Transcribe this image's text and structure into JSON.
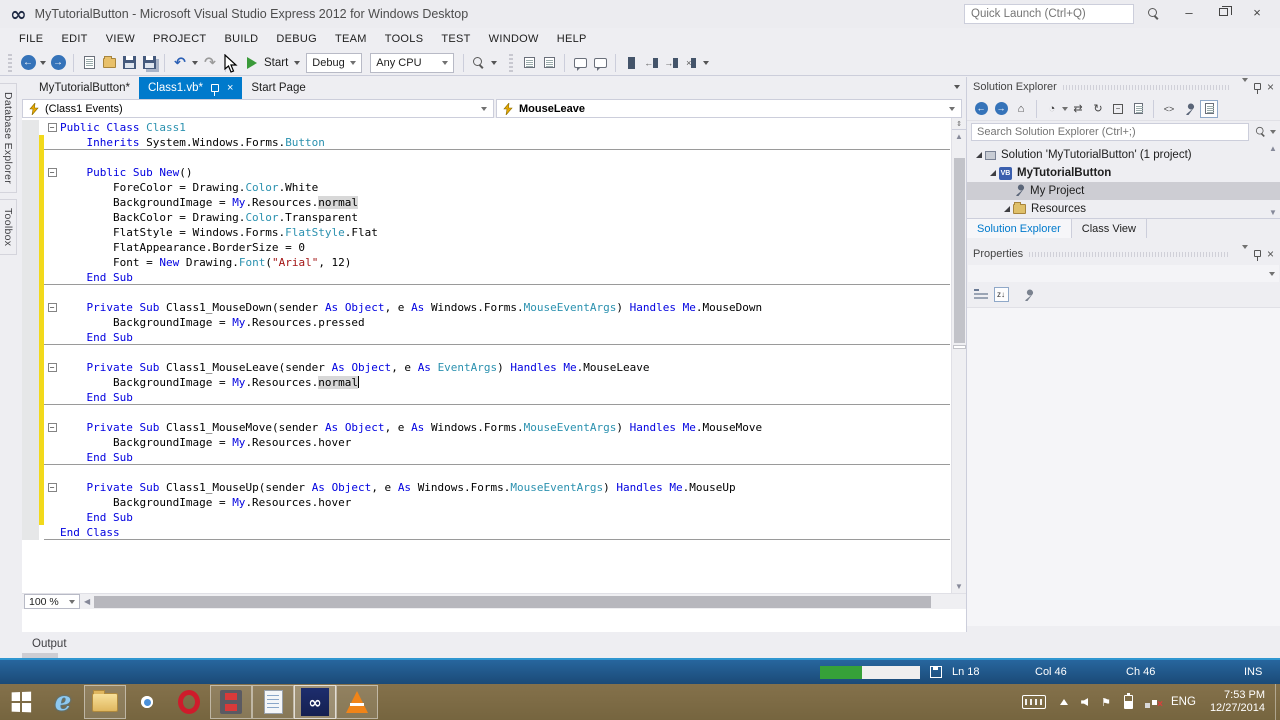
{
  "colors": {
    "accent": "#007acc",
    "keyword": "#0000e0",
    "type_name": "#2b91af",
    "string": "#a31515",
    "change_bar": "#f2d91b",
    "statusbar": "#1b4a77",
    "progress_green": "#36a139",
    "taskbar": "#7d6b46"
  },
  "window": {
    "title": "MyTutorialButton - Microsoft Visual Studio Express 2012 for Windows Desktop",
    "quick_launch_placeholder": "Quick Launch (Ctrl+Q)",
    "minimize": "–",
    "close": "×"
  },
  "menu": {
    "items": [
      "FILE",
      "EDIT",
      "VIEW",
      "PROJECT",
      "BUILD",
      "DEBUG",
      "TEAM",
      "TOOLS",
      "TEST",
      "WINDOW",
      "HELP"
    ]
  },
  "toolbar": {
    "start_label": "Start",
    "config_value": "Debug",
    "platform_value": "Any CPU"
  },
  "side_tabs": {
    "items": [
      "Database Explorer",
      "Toolbox"
    ]
  },
  "editor": {
    "tabs": [
      {
        "label": "MyTutorialButton*"
      },
      {
        "label": "Class1.vb*"
      },
      {
        "label": "Start Page"
      }
    ],
    "nav": {
      "types_value": "(Class1 Events)",
      "members_value": "MouseLeave"
    },
    "zoom_value": "100 %",
    "code": {
      "lines": [
        {
          "fold": true,
          "changed": false,
          "sep": false,
          "segments": [
            [
              "k",
              "Public Class "
            ],
            [
              "t",
              "Class1"
            ]
          ]
        },
        {
          "fold": false,
          "changed": true,
          "sep": true,
          "segments": [
            [
              "n",
              "    "
            ],
            [
              "k",
              "Inherits "
            ],
            [
              "n",
              "System.Windows.Forms."
            ],
            [
              "t",
              "Button"
            ]
          ]
        },
        {
          "fold": false,
          "changed": true,
          "sep": false,
          "segments": []
        },
        {
          "fold": true,
          "changed": true,
          "sep": false,
          "segments": [
            [
              "n",
              "    "
            ],
            [
              "k",
              "Public Sub New"
            ],
            [
              "n",
              "()"
            ]
          ]
        },
        {
          "fold": false,
          "changed": true,
          "sep": false,
          "segments": [
            [
              "n",
              "        ForeColor = Drawing."
            ],
            [
              "t",
              "Color"
            ],
            [
              "n",
              ".White"
            ]
          ]
        },
        {
          "fold": false,
          "changed": true,
          "sep": false,
          "segments": [
            [
              "n",
              "        BackgroundImage = "
            ],
            [
              "k",
              "My"
            ],
            [
              "n",
              ".Resources."
            ],
            [
              "h",
              "normal"
            ]
          ]
        },
        {
          "fold": false,
          "changed": true,
          "sep": false,
          "segments": [
            [
              "n",
              "        BackColor = Drawing."
            ],
            [
              "t",
              "Color"
            ],
            [
              "n",
              ".Transparent"
            ]
          ]
        },
        {
          "fold": false,
          "changed": true,
          "sep": false,
          "segments": [
            [
              "n",
              "        FlatStyle = Windows.Forms."
            ],
            [
              "t",
              "FlatStyle"
            ],
            [
              "n",
              ".Flat"
            ]
          ]
        },
        {
          "fold": false,
          "changed": true,
          "sep": false,
          "segments": [
            [
              "n",
              "        FlatAppearance.BorderSize = 0"
            ]
          ]
        },
        {
          "fold": false,
          "changed": true,
          "sep": false,
          "segments": [
            [
              "n",
              "        Font = "
            ],
            [
              "k",
              "New"
            ],
            [
              "n",
              " Drawing."
            ],
            [
              "t",
              "Font"
            ],
            [
              "n",
              "("
            ],
            [
              "s",
              "\"Arial\""
            ],
            [
              "n",
              ", 12)"
            ]
          ]
        },
        {
          "fold": false,
          "changed": true,
          "sep": true,
          "segments": [
            [
              "n",
              "    "
            ],
            [
              "k",
              "End Sub"
            ]
          ]
        },
        {
          "fold": false,
          "changed": true,
          "sep": false,
          "segments": []
        },
        {
          "fold": true,
          "changed": true,
          "sep": false,
          "segments": [
            [
              "n",
              "    "
            ],
            [
              "k",
              "Private Sub "
            ],
            [
              "n",
              "Class1_MouseDown(sender "
            ],
            [
              "k",
              "As "
            ],
            [
              "k",
              "Object"
            ],
            [
              "n",
              ", e "
            ],
            [
              "k",
              "As "
            ],
            [
              "n",
              "Windows.Forms."
            ],
            [
              "t",
              "MouseEventArgs"
            ],
            [
              "n",
              ") "
            ],
            [
              "k",
              "Handles "
            ],
            [
              "k",
              "Me"
            ],
            [
              "n",
              ".MouseDown"
            ]
          ]
        },
        {
          "fold": false,
          "changed": true,
          "sep": false,
          "segments": [
            [
              "n",
              "        BackgroundImage = "
            ],
            [
              "k",
              "My"
            ],
            [
              "n",
              ".Resources.pressed"
            ]
          ]
        },
        {
          "fold": false,
          "changed": true,
          "sep": true,
          "segments": [
            [
              "n",
              "    "
            ],
            [
              "k",
              "End Sub"
            ]
          ]
        },
        {
          "fold": false,
          "changed": true,
          "sep": false,
          "segments": []
        },
        {
          "fold": true,
          "changed": true,
          "sep": false,
          "segments": [
            [
              "n",
              "    "
            ],
            [
              "k",
              "Private Sub "
            ],
            [
              "n",
              "Class1_MouseLeave(sender "
            ],
            [
              "k",
              "As "
            ],
            [
              "k",
              "Object"
            ],
            [
              "n",
              ", e "
            ],
            [
              "k",
              "As "
            ],
            [
              "t",
              "EventArgs"
            ],
            [
              "n",
              ") "
            ],
            [
              "k",
              "Handles "
            ],
            [
              "k",
              "Me"
            ],
            [
              "n",
              ".MouseLeave"
            ]
          ]
        },
        {
          "fold": false,
          "changed": true,
          "sep": false,
          "caret": true,
          "segments": [
            [
              "n",
              "        BackgroundImage = "
            ],
            [
              "k",
              "My"
            ],
            [
              "n",
              ".Resources."
            ],
            [
              "h",
              "normal"
            ]
          ]
        },
        {
          "fold": false,
          "changed": true,
          "sep": true,
          "segments": [
            [
              "n",
              "    "
            ],
            [
              "k",
              "End Sub"
            ]
          ]
        },
        {
          "fold": false,
          "changed": true,
          "sep": false,
          "segments": []
        },
        {
          "fold": true,
          "changed": true,
          "sep": false,
          "segments": [
            [
              "n",
              "    "
            ],
            [
              "k",
              "Private Sub "
            ],
            [
              "n",
              "Class1_MouseMove(sender "
            ],
            [
              "k",
              "As "
            ],
            [
              "k",
              "Object"
            ],
            [
              "n",
              ", e "
            ],
            [
              "k",
              "As "
            ],
            [
              "n",
              "Windows.Forms."
            ],
            [
              "t",
              "MouseEventArgs"
            ],
            [
              "n",
              ") "
            ],
            [
              "k",
              "Handles "
            ],
            [
              "k",
              "Me"
            ],
            [
              "n",
              ".MouseMove"
            ]
          ]
        },
        {
          "fold": false,
          "changed": true,
          "sep": false,
          "segments": [
            [
              "n",
              "        BackgroundImage = "
            ],
            [
              "k",
              "My"
            ],
            [
              "n",
              ".Resources.hover"
            ]
          ]
        },
        {
          "fold": false,
          "changed": true,
          "sep": true,
          "segments": [
            [
              "n",
              "    "
            ],
            [
              "k",
              "End Sub"
            ]
          ]
        },
        {
          "fold": false,
          "changed": true,
          "sep": false,
          "segments": []
        },
        {
          "fold": true,
          "changed": true,
          "sep": false,
          "segments": [
            [
              "n",
              "    "
            ],
            [
              "k",
              "Private Sub "
            ],
            [
              "n",
              "Class1_MouseUp(sender "
            ],
            [
              "k",
              "As "
            ],
            [
              "k",
              "Object"
            ],
            [
              "n",
              ", e "
            ],
            [
              "k",
              "As "
            ],
            [
              "n",
              "Windows.Forms."
            ],
            [
              "t",
              "MouseEventArgs"
            ],
            [
              "n",
              ") "
            ],
            [
              "k",
              "Handles "
            ],
            [
              "k",
              "Me"
            ],
            [
              "n",
              ".MouseUp"
            ]
          ]
        },
        {
          "fold": false,
          "changed": true,
          "sep": false,
          "segments": [
            [
              "n",
              "        BackgroundImage = "
            ],
            [
              "k",
              "My"
            ],
            [
              "n",
              ".Resources.hover"
            ]
          ]
        },
        {
          "fold": false,
          "changed": true,
          "sep": false,
          "segments": [
            [
              "n",
              "    "
            ],
            [
              "k",
              "End Sub"
            ]
          ]
        },
        {
          "fold": false,
          "changed": false,
          "sep": true,
          "segments": [
            [
              "k",
              "End Class"
            ]
          ]
        }
      ]
    }
  },
  "solution_explorer": {
    "title": "Solution Explorer",
    "search_placeholder": "Search Solution Explorer (Ctrl+;)",
    "tree": [
      {
        "label": "Solution 'MyTutorialButton' (1 project)"
      },
      {
        "label": "MyTutorialButton"
      },
      {
        "label": "My Project"
      },
      {
        "label": "Resources"
      }
    ],
    "bottom_tabs": [
      "Solution Explorer",
      "Class View"
    ]
  },
  "properties": {
    "title": "Properties"
  },
  "output": {
    "label": "Output"
  },
  "status_bar": {
    "line": "Ln 18",
    "col": "Col 46",
    "ch": "Ch 46",
    "mode": "INS",
    "progress_pct": 42
  },
  "taskbar": {
    "tray": {
      "lang": "ENG",
      "time": "7:53 PM",
      "date": "12/27/2014"
    }
  }
}
